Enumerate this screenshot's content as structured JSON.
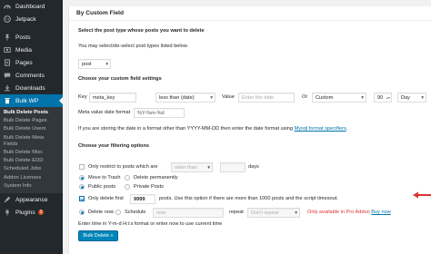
{
  "sidebar": {
    "items_top": [
      {
        "label": "Dashboard",
        "icon": "dashboard-icon"
      },
      {
        "label": "Jetpack",
        "icon": "jetpack-icon"
      },
      {
        "label": "Posts",
        "icon": "pin-icon"
      },
      {
        "label": "Media",
        "icon": "media-icon"
      },
      {
        "label": "Pages",
        "icon": "pages-icon"
      },
      {
        "label": "Comments",
        "icon": "comments-icon"
      },
      {
        "label": "Downloads",
        "icon": "download-icon"
      }
    ],
    "active": {
      "label": "Bulk WP",
      "icon": "trash-icon"
    },
    "submenu": [
      "Bulk Delete Posts",
      "Bulk Delete Pages",
      "Bulk Delete Users",
      "Bulk Delete Meta Fields",
      "Bulk Delete Misc",
      "Bulk Delete EDD",
      "Scheduled Jobs",
      "Addon Licenses",
      "System Info"
    ],
    "items_bottom": [
      {
        "label": "Appearance",
        "icon": "appearance-icon"
      },
      {
        "label": "Plugins",
        "icon": "plugins-icon",
        "badge": "3"
      }
    ]
  },
  "panel": {
    "header": "By Custom Field",
    "post_type_heading": "Select the post type whose posts you want to delete",
    "post_type_hint": "You may select/de-select post types listed below.",
    "post_type_value": "post",
    "custom_field_heading": "Choose your custom field settings",
    "key_label": "Key",
    "key_value": "meta_key",
    "compare_value": "less than (date)",
    "value_label": "Value",
    "date_placeholder": "Enter the date",
    "or_label": "Or",
    "relative_value": "Custom",
    "number_value": "90",
    "unit_value": "Day",
    "format_label": "Meta value date format",
    "format_value": "%Y-%m-%d",
    "format_note": "If you are storing the date in a format other than YYYY-MM-DD then enter the date format using",
    "format_link": "Mysql format specifiers",
    "format_note_end": ".",
    "filter_heading": "Choose your filtering options",
    "only_restrict_label": "Only restrict to posts which are",
    "older_than_value": "older than",
    "days_label": "days",
    "move_trash_label": "Move to Trash",
    "delete_perm_label": "Delete permanently",
    "public_label": "Public posts",
    "private_label": "Private Posts",
    "only_delete_label": "Only delete first",
    "limit_value": "9999",
    "limit_note": "posts. Use this option if there are more than 1000 posts and the script timesout.",
    "delete_now_label": "Delete now",
    "schedule_label": "Schedule",
    "schedule_placeholder": "now",
    "repeat_label": "repeat",
    "repeat_value": "Don't repeat",
    "pro_note": "Only available in Pro Addon",
    "buy_link": "Buy now",
    "time_hint": "Enter time in Y-m-d H:i:s format or enter now to use current time",
    "delete_button": "Bulk Delete »"
  },
  "colors": {
    "sidebar_bg": "#23282d",
    "submenu_bg": "#32373c",
    "accent": "#0073aa",
    "button": "#0085ba",
    "warning": "#dc3232"
  }
}
